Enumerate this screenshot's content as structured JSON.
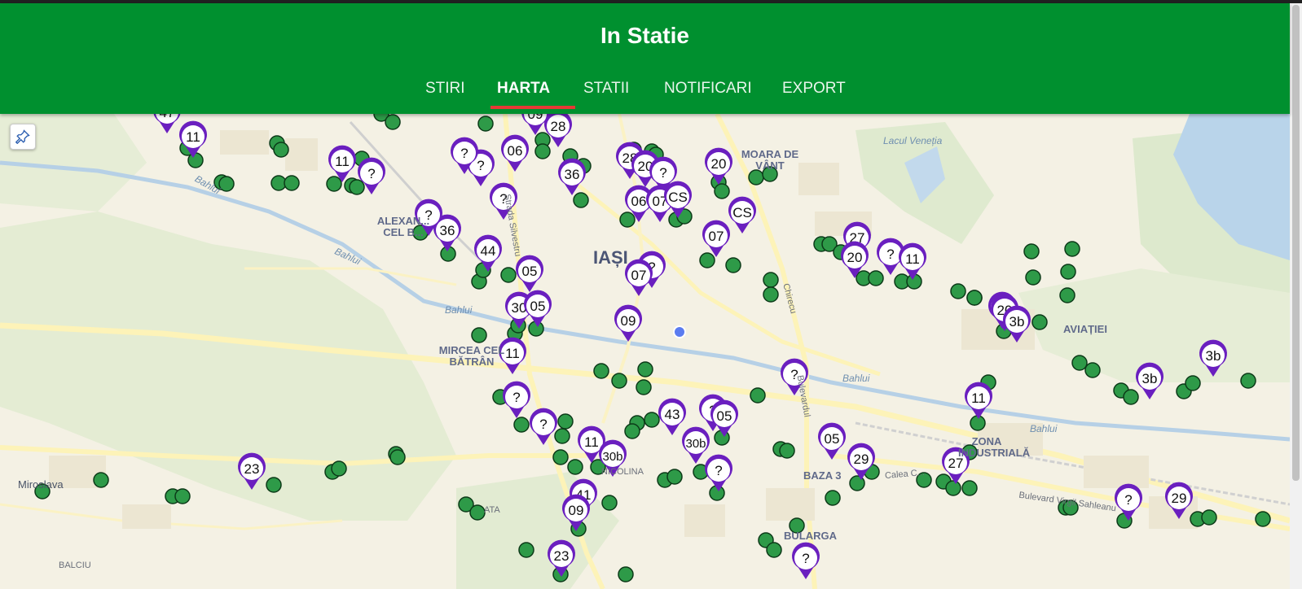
{
  "app": {
    "title": "In Statie"
  },
  "tabs": [
    {
      "label": "STIRI",
      "active": false
    },
    {
      "label": "HARTA",
      "active": true
    },
    {
      "label": "STATII",
      "active": false
    },
    {
      "label": "NOTIFICARI",
      "active": false
    },
    {
      "label": "EXPORT",
      "active": false
    }
  ],
  "colors": {
    "header": "#00902f",
    "tab_indicator": "#e53935",
    "route_marker": "#6a1fbf",
    "stop_dot": "#2e9a48",
    "location_dot": "#5b7cf0"
  },
  "map": {
    "pin_control_icon": "pin-icon",
    "labels": {
      "city": "IAȘI",
      "moara": "MOARA DE VÂNT",
      "lacul": "Lacul Veneția",
      "alexandru": "ALEXAN... CEL B...",
      "mircea": "MIRCEA CEL BĂTRÂN",
      "aviatiei": "AVIAȚIEI",
      "zona": "ZONA INDUSTRIALĂ",
      "baza": "BAZA 3",
      "bularga": "BULARGA",
      "balciu": "BALCIU",
      "mirolava": "Miroslava",
      "bahlui1": "Bahlui",
      "bahlui2": "Bahlui",
      "bahlui3": "Bahlui",
      "bahlui4": "Bahlui",
      "bahlui5": "Bahlui",
      "bulevard1": "Bulevardul",
      "bulevard2": "Bulevard Virgil Sahleanu",
      "nicolina": "NICOLINA",
      "stata": "ATA",
      "calea": "Calea C...",
      "strada": "Strada Silvestru",
      "chirecu": "Chirecu"
    },
    "route_markers": [
      "47",
      "11",
      "11",
      "?",
      "06",
      "?",
      "?",
      "28",
      "09",
      "36",
      "28",
      "20",
      "?",
      "06",
      "07",
      "CS",
      "20",
      "CS",
      "07",
      "?",
      "36",
      "44",
      "05",
      "30",
      "05",
      "07",
      "?",
      "09",
      "11",
      "?",
      "?",
      "11",
      "30b",
      "43",
      "?",
      "05",
      "30b",
      "?",
      "41",
      "09",
      "23",
      "23",
      "?",
      "27",
      "20",
      "?",
      "11",
      "20",
      "3b",
      "3b",
      "3b",
      "11",
      "05",
      "29",
      "27",
      "?",
      "29",
      "?"
    ]
  }
}
